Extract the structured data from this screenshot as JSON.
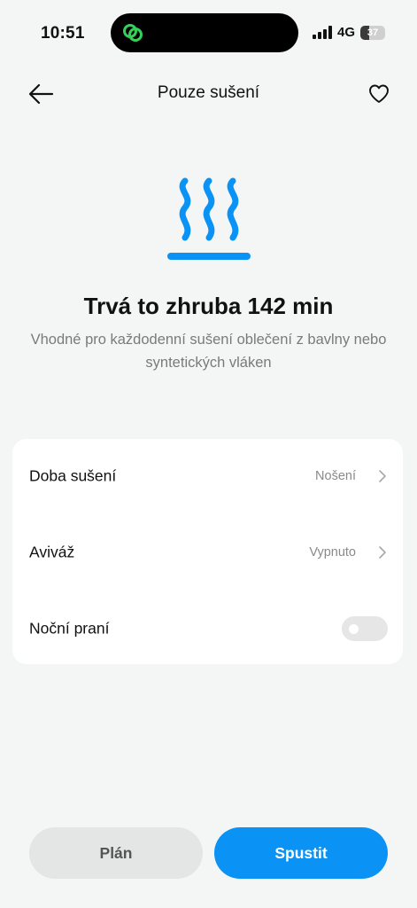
{
  "status_bar": {
    "time": "10:51",
    "network": "4G",
    "battery": "37",
    "battery_level_pct": 37,
    "icons": [
      "app-link-icon",
      "signal-icon",
      "battery-icon"
    ]
  },
  "header": {
    "title": "Pouze sušení",
    "back_icon": "arrow-left-icon",
    "favorite_icon": "heart-outline-icon"
  },
  "hero": {
    "icon": "heat-waves-icon",
    "duration_title": "Trvá to zhruba 142 min",
    "description": "Vhodné pro každodenní sušení oblečení z bavlny nebo syntetických vláken"
  },
  "settings": {
    "items": [
      {
        "label": "Doba sušení",
        "value": "Nošení",
        "type": "select"
      },
      {
        "label": "Aviváž",
        "value": "Vypnuto",
        "type": "select"
      },
      {
        "label": "Noční praní",
        "type": "toggle",
        "enabled": false
      }
    ]
  },
  "actions": {
    "plan_label": "Plán",
    "start_label": "Spustit"
  },
  "colors": {
    "accent": "#0a93f5",
    "background": "#f4f6f6",
    "card": "#ffffff",
    "secondary_button": "#e4e6e6",
    "island_icon": "#34d058"
  }
}
